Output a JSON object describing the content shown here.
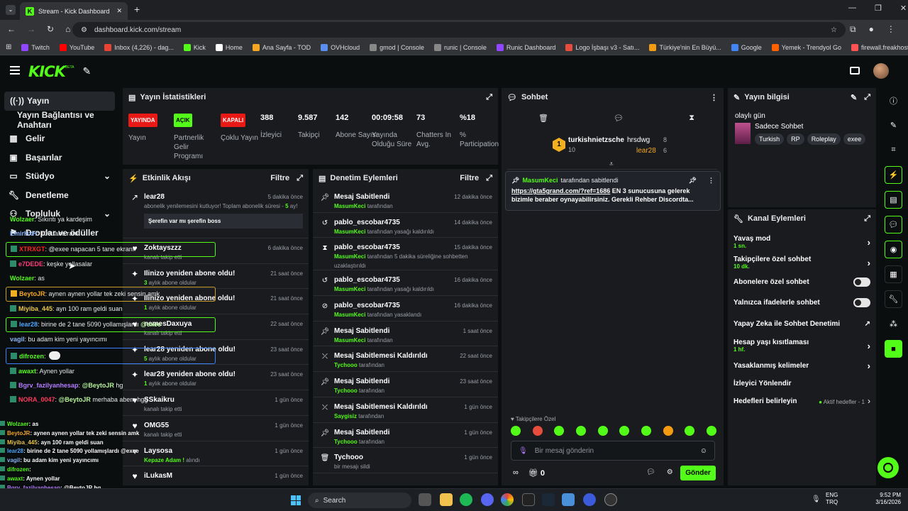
{
  "browser": {
    "tab_title": "Stream - Kick Dashboard",
    "url": "dashboard.kick.com/stream",
    "bookmarks": [
      "Twitch",
      "YouTube",
      "Inbox (4,226) - dag...",
      "Kick",
      "Home",
      "Ana Sayfa - TOD",
      "OVHcloud",
      "gmod | Console",
      "runic | Console",
      "Runic Dashboard",
      "Logo İşbaşı v3 - Satı...",
      "Türkiye'nin En Büyü...",
      "Google",
      "Yemek - Trendyol Go",
      "firewall.freakhosting..."
    ]
  },
  "app": {
    "logo": "KICK",
    "beta": "BETA"
  },
  "sidebar": {
    "items": [
      {
        "label": "Yayın",
        "icon": "broadcast-icon"
      },
      {
        "label": "Yayın Bağlantısı ve Anahtarı"
      },
      {
        "label": "Gelir",
        "icon": "revenue-icon"
      },
      {
        "label": "Başarılar",
        "icon": "achievements-icon"
      },
      {
        "label": "Stüdyo",
        "icon": "studio-icon"
      },
      {
        "label": "Denetleme",
        "icon": "wrench-icon"
      },
      {
        "label": "Topluluk",
        "icon": "community-icon"
      },
      {
        "label": "Droplar ve ödüller",
        "icon": "drops-icon"
      }
    ]
  },
  "stats": {
    "title": "Yayın İstatistikleri",
    "cols": [
      {
        "badge": "YAYINDA",
        "label": "Yayın",
        "color": "#e91916"
      },
      {
        "badge": "AÇIK",
        "label": "Partnerlik Gelir Programı",
        "color": "#53fc18"
      },
      {
        "badge": "KAPALI",
        "label": "Çoklu Yayın",
        "color": "#e91916"
      },
      {
        "value": "388",
        "label": "İzleyici"
      },
      {
        "value": "9.587",
        "label": "Takipçi"
      },
      {
        "value": "142",
        "label": "Abone Sayısı"
      },
      {
        "value": "00:09:58",
        "label": "Yayında Olduğu Süre"
      },
      {
        "value": "73",
        "label": "Chatters In Avg."
      },
      {
        "value": "%18",
        "label": "% Participation"
      }
    ]
  },
  "feed": {
    "title": "Etkinlik Akışı",
    "filter": "Filtre",
    "items": [
      {
        "name": "lear28",
        "time": "5 dakika önce",
        "sub": "abonelik yenilemesini kutluyor! Toplam abonelik süresi - ",
        "num": "5",
        "suffix": " ay!",
        "msg": "Şerefin var mı şerefin boss"
      },
      {
        "name": "Zoktayszzz",
        "time": "6 dakika önce",
        "sub": "kanalı takip etti"
      },
      {
        "name": "Ilinizo yeniden abone oldu!",
        "time": "21 saat önce",
        "num": "3",
        "sub": " aylık abone oldular"
      },
      {
        "name": "Ilinizo yeniden abone oldu!",
        "time": "21 saat önce",
        "num": "1",
        "sub": " aylık abone oldular"
      },
      {
        "name": "nemesDaxuya",
        "time": "22 saat önce",
        "sub": "kanalı takip etti"
      },
      {
        "name": "lear28 yeniden abone oldu!",
        "time": "23 saat önce",
        "num": "5",
        "sub": " aylık abone oldular"
      },
      {
        "name": "lear28 yeniden abone oldu!",
        "time": "23 saat önce",
        "num": "1",
        "sub": " aylık abone oldular"
      },
      {
        "name": "SSkaikru",
        "time": "1 gün önce",
        "sub": "kanalı takip etti"
      },
      {
        "name": "OMG55",
        "time": "1 gün önce",
        "sub": "kanalı takip etti"
      },
      {
        "name": "Laysosa",
        "time": "1 gün önce",
        "num": "Kepaze Adam !",
        "sub": " alındı"
      },
      {
        "name": "iLukasM",
        "time": "1 gün önce"
      }
    ]
  },
  "mod": {
    "title": "Denetim Eylemleri",
    "filter": "Filtre",
    "items": [
      {
        "name": "Mesaj Sabitlendi",
        "time": "12 dakika önce",
        "who": "MasumKeci",
        "sub": " tarafından"
      },
      {
        "name": "pablo_escobar4735",
        "time": "14 dakika önce",
        "who": "MasumKeci",
        "sub": " tarafından yasağı kaldırıldı"
      },
      {
        "name": "pablo_escobar4735",
        "time": "15 dakika önce",
        "who": "MasumKeci",
        "sub": " tarafından 5 dakika süreliğine sohbetten uzaklaştırıldı"
      },
      {
        "name": "pablo_escobar4735",
        "time": "16 dakika önce",
        "who": "MasumKeci",
        "sub": " tarafından yasağı kaldırıldı"
      },
      {
        "name": "pablo_escobar4735",
        "time": "16 dakika önce",
        "who": "MasumKeci",
        "sub": " tarafından yasaklandı"
      },
      {
        "name": "Mesaj Sabitlendi",
        "time": "1 saat önce",
        "who": "MasumKeci",
        "sub": " tarafından"
      },
      {
        "name": "Mesaj Sabitlemesi Kaldırıldı",
        "time": "22 saat önce",
        "who": "Tychooo",
        "sub": " tarafından"
      },
      {
        "name": "Mesaj Sabitlendi",
        "time": "23 saat önce",
        "who": "Tychooo",
        "sub": " tarafından"
      },
      {
        "name": "Mesaj Sabitlemesi Kaldırıldı",
        "time": "1 gün önce",
        "who": "Saygisiz",
        "sub": " tarafından"
      },
      {
        "name": "Mesaj Sabitlendi",
        "time": "1 gün önce",
        "who": "Tychooo",
        "sub": " tarafından"
      },
      {
        "name": "Tychooo",
        "time": "1 gün önce",
        "sub": "bir mesajı sildi"
      }
    ]
  },
  "chat": {
    "title": "Sohbet",
    "top1": {
      "name": "turkishnietzsche",
      "count": "10"
    },
    "top2": {
      "name": "hrsdwg",
      "count": "8"
    },
    "top3": {
      "name": "lear28",
      "count": "6"
    },
    "pinned_by": "MasumKeci",
    "pinned_suffix": " tarafından sabitlendi",
    "pinned_link": "https://gta5grand.com/?ref=1686",
    "pinned_text": " EN 3 sunucusuna gelerek bizimle beraber oynayabilirsiniz. Gerekli Rehber Discordta...",
    "messages": [
      {
        "user": "Wolzaer",
        "color": "#53fc18",
        "text": ": Sıkıntı ya kardeşim"
      },
      {
        "user": "EmirHxH",
        "color": "#8ab4f8",
        "text": ": 100 tane ram"
      },
      {
        "user": "XTRXGT",
        "color": "#ff2222",
        "text": ": @exee napacan 5 tane ekranı"
      },
      {
        "user": "e7DEDE",
        "color": "#ff3b7a",
        "text": ": keşke yollasalar"
      },
      {
        "user": "Wolzaer",
        "color": "#53fc18",
        "text": ": as"
      },
      {
        "user": "BeytoJR",
        "color": "#f5a623",
        "text": ": aynen aynen yollar tek zeki sensin amk"
      },
      {
        "user": "Miyiba_445",
        "color": "#e8c547",
        "text": ": ayn 100 ram geldi suan"
      },
      {
        "user": "lear28",
        "color": "#4aa8ff",
        "text": ": birine de 2 tane 5090 yollamışlardı ",
        "mention": "@exee"
      },
      {
        "user": "vagil",
        "color": "#8ab4f8",
        "text": ": bu adam kim yeni yayıncımı"
      },
      {
        "user": "difrozen",
        "color": "#53fc18",
        "text": ":"
      },
      {
        "user": "awaxt",
        "color": "#53fc18",
        "text": ": Aynen yollar"
      },
      {
        "user": "Bgrv_fazilyanhesap",
        "color": "#b57cff",
        "text": ": ",
        "mention": "@BeytoJR",
        "after": " hg"
      },
      {
        "user": "NORA_0047",
        "color": "#ff3b5c",
        "text": ": ",
        "mention": "@BeytoJR",
        "after": " merhaba abem hgg"
      }
    ],
    "followers_only": "Takipçilere Özel",
    "placeholder": "Bir mesaj gönderin",
    "bottom_count": "0",
    "send": "Gönder"
  },
  "info": {
    "title": "Yayın bilgisi",
    "stream_title": "olaylı gün",
    "category": "Sadece Sohbet",
    "tags": [
      "Turkish",
      "RP",
      "Roleplay",
      "exee"
    ]
  },
  "actions": {
    "title": "Kanal Eylemleri",
    "items": [
      {
        "label": "Yavaş mod",
        "sub": "1 sn."
      },
      {
        "label": "Takipçilere özel sohbet",
        "sub": "10 dk."
      },
      {
        "label": "Abonelere özel sohbet"
      },
      {
        "label": "Yalnızca ifadelerle sohbet"
      },
      {
        "label": "Yapay Zeka ile Sohbet Denetimi"
      },
      {
        "label": "Hesap yaşı kısıtlaması",
        "sub": "1 hf."
      },
      {
        "label": "Yasaklanmış kelimeler"
      },
      {
        "label": "İzleyici Yönlendir"
      },
      {
        "label": "Hedefleri belirleyin",
        "status": "Aktif hedefler - 1"
      }
    ]
  },
  "overlay": [
    {
      "user": "Wolzaer",
      "text": ": as",
      "color": "#53fc18"
    },
    {
      "user": "BeytoJR",
      "text": ": aynen aynen yollar tek zeki sensin amk",
      "color": "#f5a623"
    },
    {
      "user": "Miyiba_445",
      "text": ": ayn 100 ram geldi suan",
      "color": "#e8c547"
    },
    {
      "user": "lear28",
      "text": ": birine de 2 tane 5090 yollamışlardı @exee",
      "color": "#4aa8ff"
    },
    {
      "user": "vagil",
      "text": ": bu adam kim yeni yayıncımı",
      "color": "#8ab4f8"
    },
    {
      "user": "difrozen",
      "text": ":",
      "color": "#53fc18"
    },
    {
      "user": "awaxt",
      "text": ": Aynen yollar",
      "color": "#53fc18"
    },
    {
      "user": "Bgrv_fazilyanhesap",
      "text": ": @BeytoJR hg",
      "color": "#b57cff"
    },
    {
      "user": "NORA_0047",
      "text": ": @BeytoJR merhaba abem hgg",
      "color": "#ff3b5c"
    }
  ],
  "taskbar": {
    "search": "Search",
    "lang1": "ENG",
    "lang2": "TRQ",
    "time": "9:52 PM",
    "date": "3/16/2026"
  }
}
